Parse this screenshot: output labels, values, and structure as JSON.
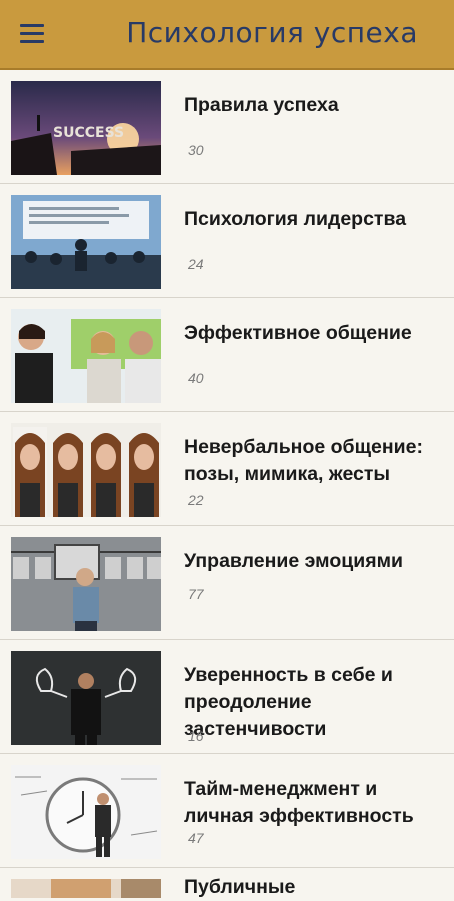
{
  "app": {
    "title": "Психология успеха",
    "menu_icon": "hamburger-menu-icon"
  },
  "items": [
    {
      "title": "Правила успеха",
      "count": "30",
      "image": "success-silhouette"
    },
    {
      "title": "Психология лидерства",
      "count": "24",
      "image": "presentation-audience"
    },
    {
      "title": "Эффективное общение",
      "count": "40",
      "image": "business-conversation"
    },
    {
      "title": "Невербальное общение: позы, мимика, жесты",
      "count": "22",
      "image": "woman-facial-expressions"
    },
    {
      "title": "Управление эмоциями",
      "count": "77",
      "image": "man-with-frames"
    },
    {
      "title": "Уверенность в себе и преодоление застенчивости",
      "count": "16",
      "image": "man-chalkboard-muscles"
    },
    {
      "title": "Тайм-менеджмент и личная эффективность",
      "count": "47",
      "image": "man-giant-clock"
    },
    {
      "title": "Публичные",
      "count": "",
      "image": "public-speaking"
    }
  ]
}
